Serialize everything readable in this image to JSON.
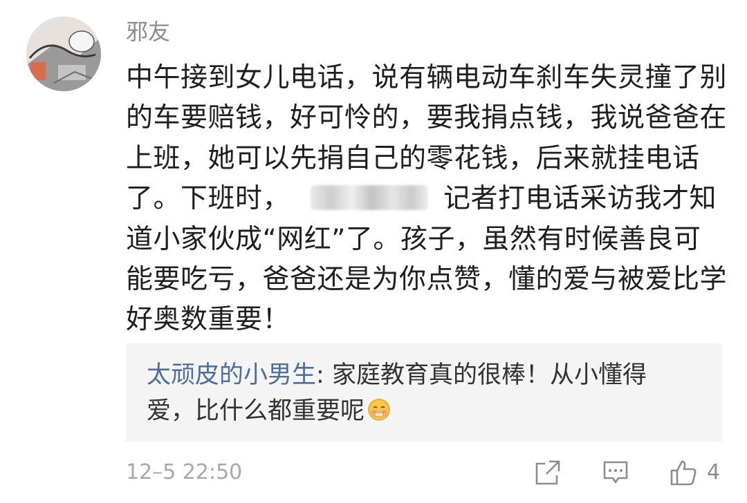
{
  "comment": {
    "author": "邪友",
    "text_before": "中午接到女儿电话，说有辆电动车刹车失灵撞了别的车要赔钱，好可怜的，要我捐点钱，我说爸爸在上班，她可以先捐自己的零花钱，后来就挂电话了。下班时，",
    "text_after": "记者打电话采访我才知道小家伙成“网红”了。孩子，虽然有时候善良可能要吃亏，爸爸还是为你点赞，懂的爱与被爱比学好奥数重要！",
    "timestamp": "12–5 22:50",
    "like_count": "4"
  },
  "reply": {
    "username": "太顽皮的小男生",
    "separator": ": ",
    "text": "家庭教育真的很棒！从小懂得爱，比什么都重要呢",
    "emoji": "blushing-face-emoji"
  },
  "colors": {
    "username_blue": "#4d6e9a",
    "text_dark": "#1e1e1e",
    "meta_gray": "#a8a8a8",
    "reply_bg": "#f4f4f4"
  },
  "icons": {
    "share": "share-icon",
    "comment": "comment-icon",
    "like": "thumbs-up-icon"
  }
}
